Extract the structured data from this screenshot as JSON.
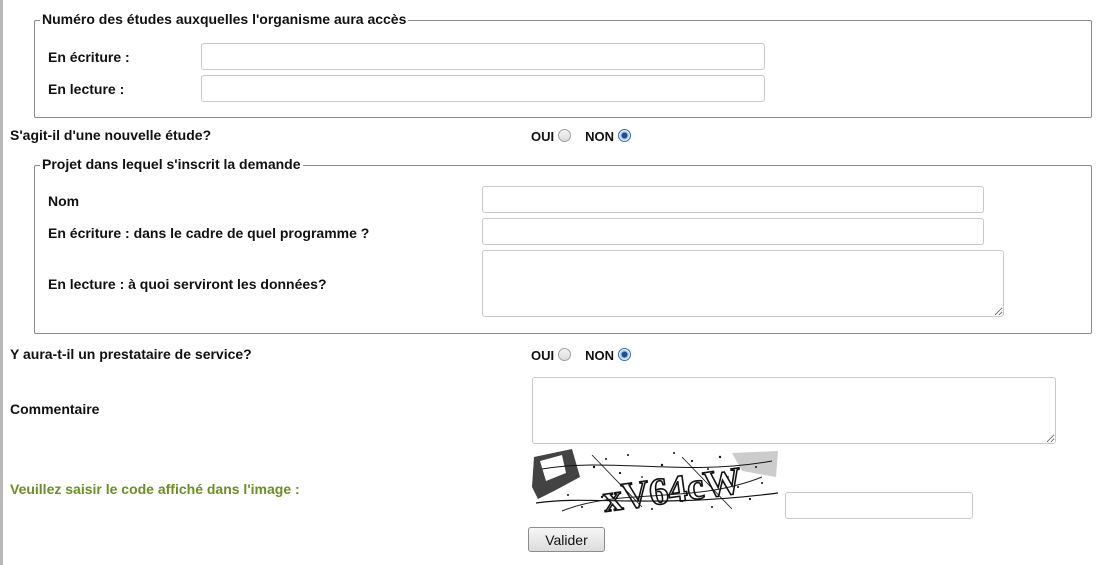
{
  "access_section": {
    "legend": "Numéro des études auxquelles l'organisme aura accès",
    "write_label": "En écriture :",
    "write_value": "",
    "read_label": "En lecture :",
    "read_value": ""
  },
  "new_study": {
    "question": "S'agit-il d'une nouvelle étude?",
    "oui_label": "OUI",
    "non_label": "NON",
    "selected": "NON"
  },
  "project_section": {
    "legend": "Projet dans lequel s'inscrit la demande",
    "name_label": "Nom",
    "name_value": "",
    "write_program_label": "En écriture : dans le cadre de quel programme ?",
    "write_program_value": "",
    "read_usage_label": "En lecture : à quoi serviront les données?",
    "read_usage_value": ""
  },
  "service_provider": {
    "question": "Y aura-t-il un prestataire de service?",
    "oui_label": "OUI",
    "non_label": "NON",
    "selected": "NON"
  },
  "comment": {
    "label": "Commentaire",
    "value": ""
  },
  "captcha": {
    "prompt": "Veuillez saisir le code affiché dans l'image :",
    "code_text": "xV64cW",
    "input_value": "",
    "prompt_color": "#6b8e23"
  },
  "submit": {
    "label": "Valider"
  }
}
